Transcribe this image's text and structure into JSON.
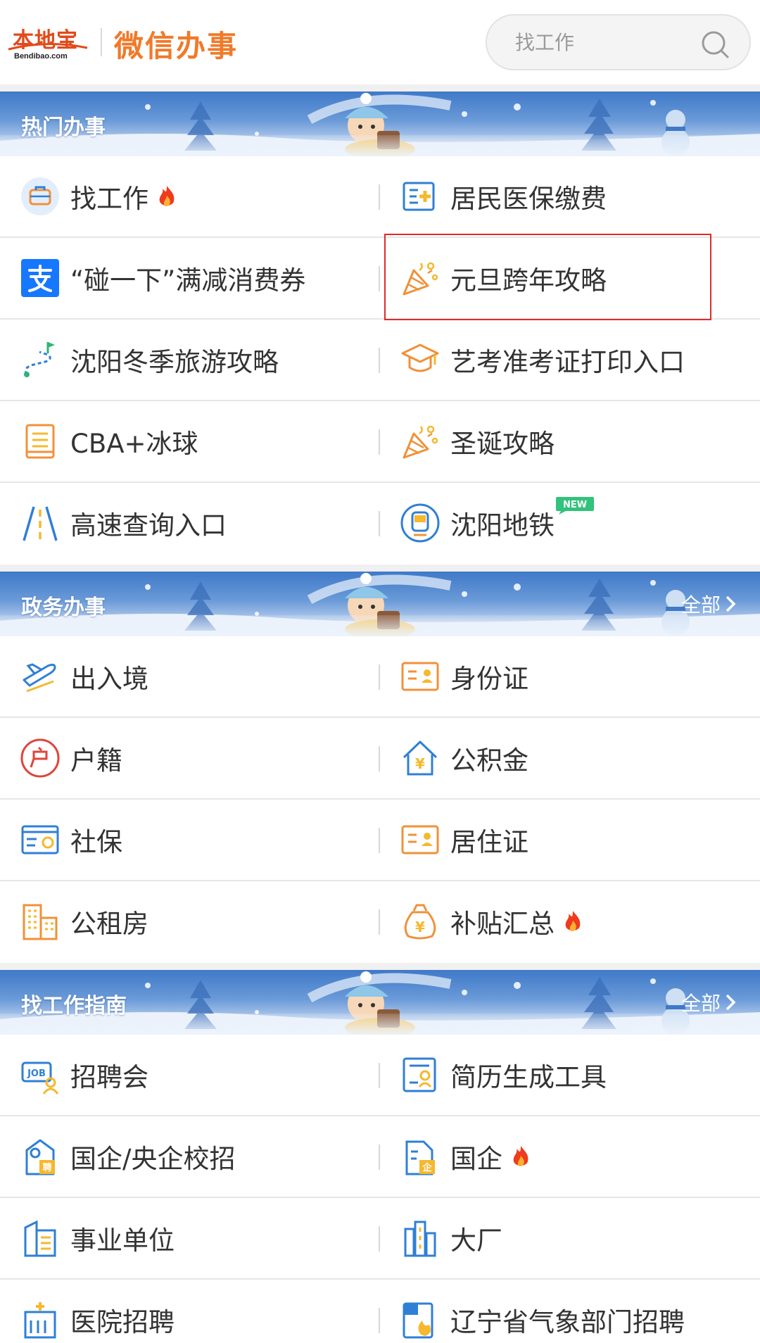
{
  "header": {
    "logo_main": "本地宝",
    "logo_sub": "Bendibao.com",
    "brand_title": "微信办事",
    "search_placeholder": "找工作"
  },
  "sections": [
    {
      "title": "热门办事",
      "more": "",
      "rows": [
        [
          {
            "label": "找工作",
            "icon": "briefcase-icon",
            "fire": true
          },
          {
            "label": "居民医保缴费",
            "icon": "medical-card-icon"
          }
        ],
        [
          {
            "label": "“碰一下”满减消费券",
            "icon": "alipay-icon"
          },
          {
            "label": "元旦跨年攻略",
            "icon": "party-popper-icon"
          }
        ],
        [
          {
            "label": "沈阳冬季旅游攻略",
            "icon": "route-flag-icon"
          },
          {
            "label": "艺考准考证打印入口",
            "icon": "graduation-cap-icon"
          }
        ],
        [
          {
            "label": "CBA+冰球",
            "icon": "document-icon"
          },
          {
            "label": "圣诞攻略",
            "icon": "party-popper-icon"
          }
        ],
        [
          {
            "label": "高速查询入口",
            "icon": "highway-icon"
          },
          {
            "label": "沈阳地铁",
            "icon": "metro-icon",
            "badge": "NEW"
          }
        ]
      ]
    },
    {
      "title": "政务办事",
      "more": "全部",
      "rows": [
        [
          {
            "label": "出入境",
            "icon": "airplane-icon"
          },
          {
            "label": "身份证",
            "icon": "id-card-icon"
          }
        ],
        [
          {
            "label": "户籍",
            "icon": "household-icon"
          },
          {
            "label": "公积金",
            "icon": "housing-fund-icon"
          }
        ],
        [
          {
            "label": "社保",
            "icon": "social-security-icon"
          },
          {
            "label": "居住证",
            "icon": "residence-card-icon"
          }
        ],
        [
          {
            "label": "公租房",
            "icon": "buildings-icon"
          },
          {
            "label": "补贴汇总",
            "icon": "money-bag-icon",
            "fire": true
          }
        ]
      ]
    },
    {
      "title": "找工作指南",
      "more": "全部",
      "rows": [
        [
          {
            "label": "招聘会",
            "icon": "job-fair-icon"
          },
          {
            "label": "简历生成工具",
            "icon": "resume-icon"
          }
        ],
        [
          {
            "label": "国企/央企校招",
            "icon": "campus-hire-icon"
          },
          {
            "label": "国企",
            "icon": "state-enterprise-icon",
            "fire": true
          }
        ],
        [
          {
            "label": "事业单位",
            "icon": "institution-icon"
          },
          {
            "label": "大厂",
            "icon": "big-company-icon"
          }
        ],
        [
          {
            "label": "医院招聘",
            "icon": "hospital-icon"
          },
          {
            "label": "辽宁省气象部门招聘",
            "icon": "weather-dept-icon"
          }
        ]
      ]
    }
  ],
  "colors": {
    "brand_orange": "#f07a2a",
    "highlight_red": "#e02a2a",
    "banner_blue": "#3f79c8",
    "fire_red": "#ee3b1e"
  }
}
